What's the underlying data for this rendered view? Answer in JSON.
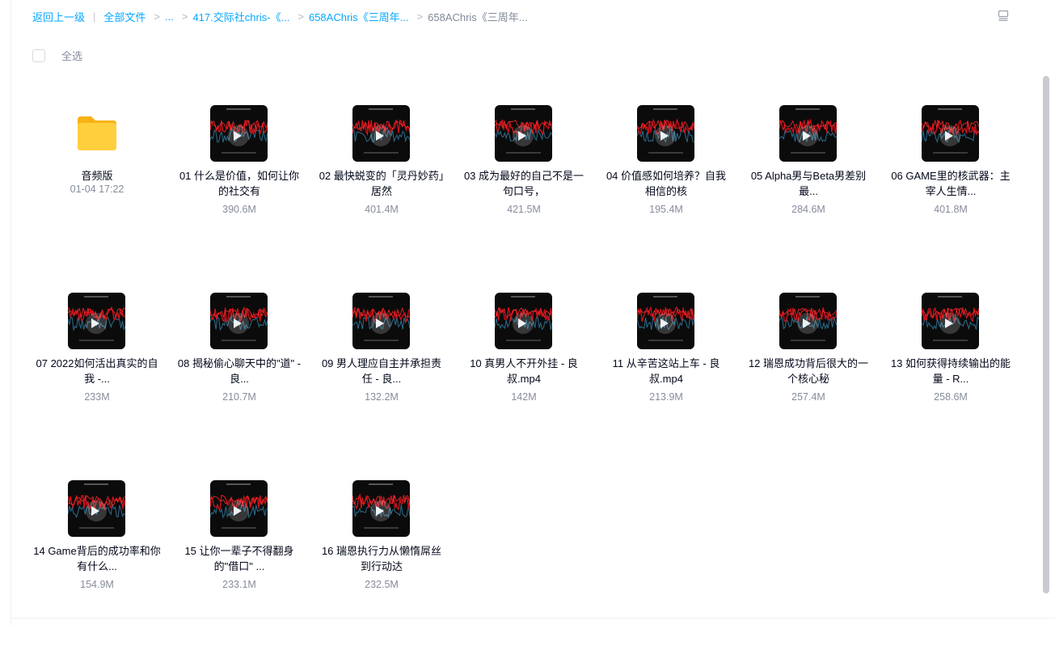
{
  "breadcrumb": {
    "back": "返回上一级",
    "all_files": "全部文件",
    "ellipsis": "...",
    "level1": "417.交际社chris-《...",
    "level2": "658AChris《三周年...",
    "current": "658AChris《三周年..."
  },
  "toolbar": {
    "select_all": "全选"
  },
  "items": [
    {
      "type": "folder",
      "name": "音频版",
      "meta": "01-04 17:22"
    },
    {
      "type": "video",
      "name": "01 什么是价值，如何让你的社交有",
      "meta": "390.6M"
    },
    {
      "type": "video",
      "name": "02 最快蜕变的「灵丹妙药」居然",
      "meta": "401.4M"
    },
    {
      "type": "video",
      "name": "03 成为最好的自己不是一句口号，",
      "meta": "421.5M"
    },
    {
      "type": "video",
      "name": "04 价值感如何培养？自我相信的核",
      "meta": "195.4M"
    },
    {
      "type": "video",
      "name": "05 Alpha男与Beta男差别最...",
      "meta": "284.6M"
    },
    {
      "type": "video",
      "name": "06 GAME里的核武器：主宰人生情...",
      "meta": "401.8M"
    },
    {
      "type": "video",
      "name": "07 2022如何活出真实的自我 -...",
      "meta": "233M"
    },
    {
      "type": "video",
      "name": "08 揭秘偷心聊天中的\"道\" - 良...",
      "meta": "210.7M"
    },
    {
      "type": "video",
      "name": "09 男人理应自主并承担责任 - 良...",
      "meta": "132.2M"
    },
    {
      "type": "video",
      "name": "10 真男人不开外挂 - 良叔.mp4",
      "meta": "142M"
    },
    {
      "type": "video",
      "name": "11 从辛苦这站上车 - 良叔.mp4",
      "meta": "213.9M"
    },
    {
      "type": "video",
      "name": "12 瑞恩成功背后很大的一个核心秘",
      "meta": "257.4M"
    },
    {
      "type": "video",
      "name": "13 如何获得持续输出的能量 - R...",
      "meta": "258.6M"
    },
    {
      "type": "video",
      "name": "14 Game背后的成功率和你有什么...",
      "meta": "154.9M"
    },
    {
      "type": "video",
      "name": "15 让你一辈子不得翻身的\"借口\" ...",
      "meta": "233.1M"
    },
    {
      "type": "video",
      "name": "16 瑞恩执行力从懒惰屌丝到行动达",
      "meta": "232.5M"
    }
  ],
  "colors": {
    "accent": "#06a7ff",
    "folder": "#ffc52e",
    "wave_red": "#d0121b",
    "wave_blue": "#2b6d8e",
    "thumb_bg": "#0b0b0b"
  },
  "icons": {
    "view_toggle": "list-view-icon",
    "play": "play-icon",
    "folder": "folder-icon"
  }
}
